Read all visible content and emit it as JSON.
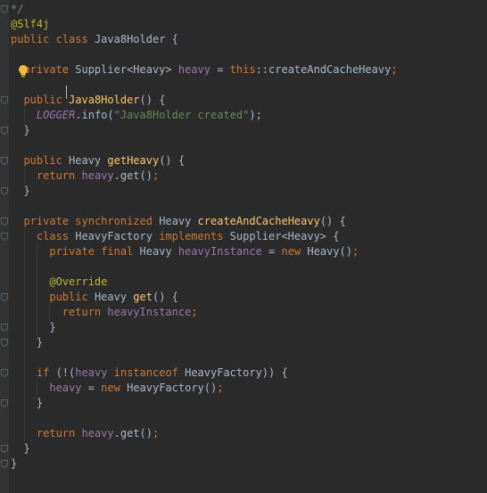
{
  "editor": {
    "language": "Java",
    "theme_colors": {
      "background": "#2b2b2b",
      "keyword": "#cc7832",
      "annotation": "#bbb529",
      "field": "#9876aa",
      "method": "#ffc66d",
      "string": "#6a8759",
      "comment": "#808080",
      "text": "#a9b7c6"
    },
    "lines": [
      [
        {
          "t": "*/",
          "c": "cmt"
        }
      ],
      [
        {
          "t": "@Slf4j",
          "c": "ann"
        }
      ],
      [
        {
          "t": "public",
          "c": "kw"
        },
        {
          "t": " ",
          "c": "pn"
        },
        {
          "t": "class",
          "c": "kw"
        },
        {
          "t": " Java8Holder {",
          "c": "pn"
        }
      ],
      [],
      [
        {
          "t": "  ",
          "c": "pn"
        },
        {
          "t": "private",
          "c": "kw"
        },
        {
          "t": " Supplier<Heavy> ",
          "c": "pn"
        },
        {
          "t": "heavy",
          "c": "fld"
        },
        {
          "t": " = ",
          "c": "pn"
        },
        {
          "t": "this",
          "c": "kw"
        },
        {
          "t": "::createAndCacheHeavy",
          "c": "pn"
        },
        {
          "t": ";",
          "c": "kw"
        }
      ],
      [],
      [
        {
          "t": "  ",
          "c": "pn"
        },
        {
          "t": "public",
          "c": "kw"
        },
        {
          "t": " ",
          "c": "pn"
        },
        {
          "t": "Java8Holder",
          "c": "fn"
        },
        {
          "t": "() {",
          "c": "pn"
        }
      ],
      [
        {
          "t": "    ",
          "c": "pn"
        },
        {
          "t": "LOGGER",
          "c": "sfld"
        },
        {
          "t": ".info(",
          "c": "pn"
        },
        {
          "t": "\"Java8Holder created\"",
          "c": "str"
        },
        {
          "t": ");",
          "c": "pn"
        }
      ],
      [
        {
          "t": "  }",
          "c": "pn"
        }
      ],
      [],
      [
        {
          "t": "  ",
          "c": "pn"
        },
        {
          "t": "public",
          "c": "kw"
        },
        {
          "t": " Heavy ",
          "c": "pn"
        },
        {
          "t": "getHeavy",
          "c": "fn"
        },
        {
          "t": "() {",
          "c": "pn"
        }
      ],
      [
        {
          "t": "    ",
          "c": "pn"
        },
        {
          "t": "return",
          "c": "kw"
        },
        {
          "t": " ",
          "c": "pn"
        },
        {
          "t": "heavy",
          "c": "fld"
        },
        {
          "t": ".get()",
          "c": "pn"
        },
        {
          "t": ";",
          "c": "kw"
        }
      ],
      [
        {
          "t": "  }",
          "c": "pn"
        }
      ],
      [],
      [
        {
          "t": "  ",
          "c": "pn"
        },
        {
          "t": "private",
          "c": "kw"
        },
        {
          "t": " ",
          "c": "pn"
        },
        {
          "t": "synchronized",
          "c": "kw"
        },
        {
          "t": " Heavy ",
          "c": "pn"
        },
        {
          "t": "createAndCacheHeavy",
          "c": "fn"
        },
        {
          "t": "() {",
          "c": "pn"
        }
      ],
      [
        {
          "t": "    ",
          "c": "pn"
        },
        {
          "t": "class",
          "c": "kw"
        },
        {
          "t": " HeavyFactory ",
          "c": "pn"
        },
        {
          "t": "implements",
          "c": "kw"
        },
        {
          "t": " Supplier<Heavy> {",
          "c": "pn"
        }
      ],
      [
        {
          "t": "      ",
          "c": "pn"
        },
        {
          "t": "private",
          "c": "kw"
        },
        {
          "t": " ",
          "c": "pn"
        },
        {
          "t": "final",
          "c": "kw"
        },
        {
          "t": " Heavy ",
          "c": "pn"
        },
        {
          "t": "heavyInstance",
          "c": "fld"
        },
        {
          "t": " = ",
          "c": "pn"
        },
        {
          "t": "new",
          "c": "kw"
        },
        {
          "t": " Heavy()",
          "c": "pn"
        },
        {
          "t": ";",
          "c": "kw"
        }
      ],
      [],
      [
        {
          "t": "      ",
          "c": "pn"
        },
        {
          "t": "@Override",
          "c": "ann"
        }
      ],
      [
        {
          "t": "      ",
          "c": "pn"
        },
        {
          "t": "public",
          "c": "kw"
        },
        {
          "t": " Heavy ",
          "c": "pn"
        },
        {
          "t": "get",
          "c": "fn"
        },
        {
          "t": "() {",
          "c": "pn"
        }
      ],
      [
        {
          "t": "        ",
          "c": "pn"
        },
        {
          "t": "return",
          "c": "kw"
        },
        {
          "t": " ",
          "c": "pn"
        },
        {
          "t": "heavyInstance",
          "c": "fld"
        },
        {
          "t": ";",
          "c": "kw"
        }
      ],
      [
        {
          "t": "      }",
          "c": "pn"
        }
      ],
      [
        {
          "t": "    }",
          "c": "pn"
        }
      ],
      [],
      [
        {
          "t": "    ",
          "c": "pn"
        },
        {
          "t": "if",
          "c": "kw"
        },
        {
          "t": " (!(",
          "c": "pn"
        },
        {
          "t": "heavy",
          "c": "fld"
        },
        {
          "t": " ",
          "c": "pn"
        },
        {
          "t": "instanceof",
          "c": "kw"
        },
        {
          "t": " HeavyFactory)) {",
          "c": "pn"
        }
      ],
      [
        {
          "t": "      ",
          "c": "pn"
        },
        {
          "t": "heavy",
          "c": "fld"
        },
        {
          "t": " = ",
          "c": "pn"
        },
        {
          "t": "new",
          "c": "kw"
        },
        {
          "t": " HeavyFactory()",
          "c": "pn"
        },
        {
          "t": ";",
          "c": "kw"
        }
      ],
      [
        {
          "t": "    }",
          "c": "pn"
        }
      ],
      [],
      [
        {
          "t": "    ",
          "c": "pn"
        },
        {
          "t": "return",
          "c": "kw"
        },
        {
          "t": " ",
          "c": "pn"
        },
        {
          "t": "heavy",
          "c": "fld"
        },
        {
          "t": ".get()",
          "c": "pn"
        },
        {
          "t": ";",
          "c": "kw"
        }
      ],
      [
        {
          "t": "  }",
          "c": "pn"
        }
      ],
      [
        {
          "t": "}",
          "c": "pn"
        }
      ]
    ],
    "icons": {
      "intention_bulb": "lightbulb-icon",
      "fold_marker": "fold-marker-icon"
    }
  }
}
